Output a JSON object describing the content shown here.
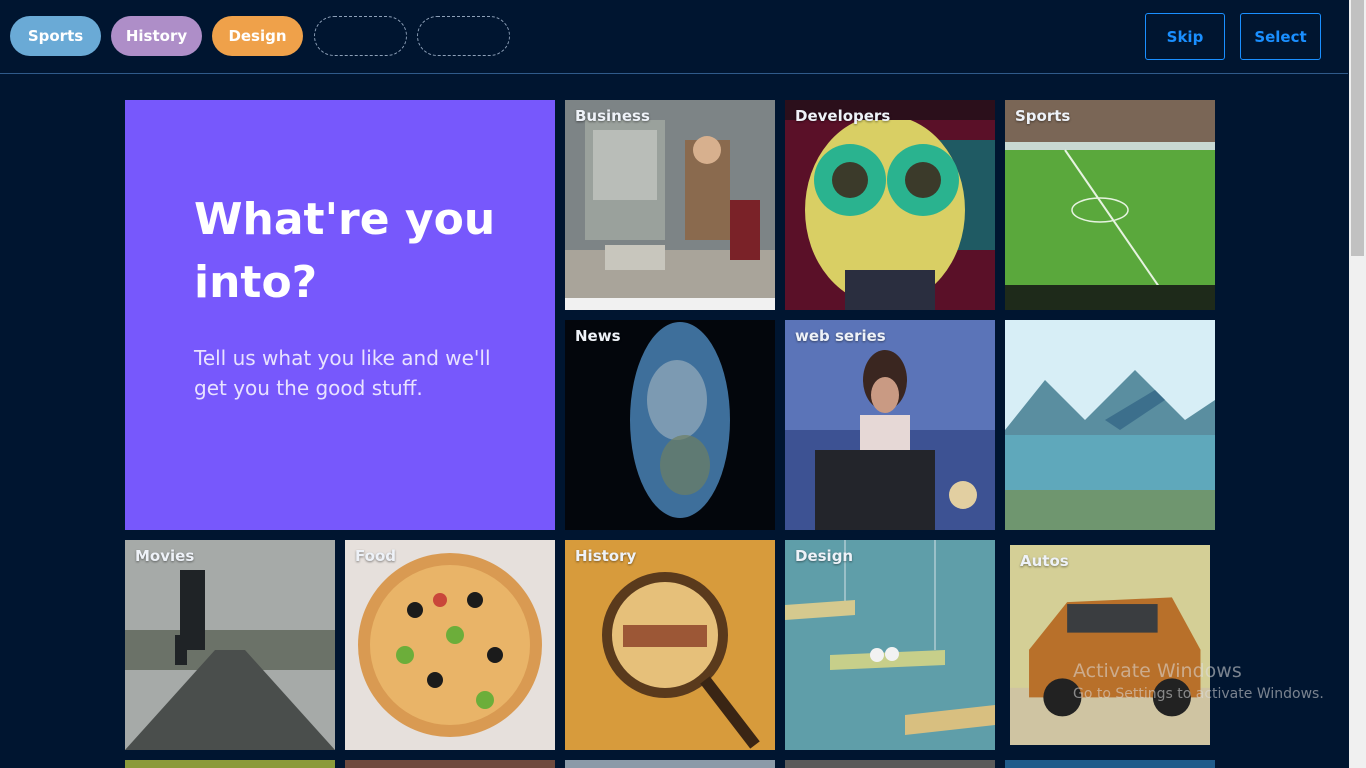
{
  "header": {
    "chips": [
      {
        "label": "Sports",
        "color": "#6aaad6"
      },
      {
        "label": "History",
        "color": "#ae8ec8"
      },
      {
        "label": "Design",
        "color": "#efa14a"
      }
    ],
    "skip_label": "Skip",
    "select_label": "Select"
  },
  "hero": {
    "title": "What're you into?",
    "subtitle": "Tell us what you like and we'll get you the good stuff."
  },
  "tiles": {
    "business": "Business",
    "developers": "Developers",
    "sports": "Sports",
    "news": "News",
    "web_series": "web series",
    "travel": "",
    "movies": "Movies",
    "food": "Food",
    "history": "History",
    "design": "Design",
    "autos": "Autos"
  },
  "watermark": {
    "title": "Activate Windows",
    "subtitle": "Go to Settings to activate Windows."
  }
}
